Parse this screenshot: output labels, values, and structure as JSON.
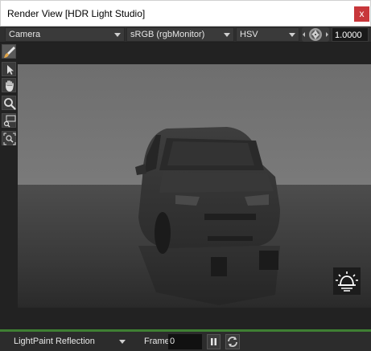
{
  "window": {
    "title": "Render View [HDR Light Studio]",
    "close_glyph": "x"
  },
  "toolbar": {
    "camera_select": "Camera",
    "colorspace_select": "sRGB (rgbMonitor)",
    "colormode_select": "HSV",
    "exposure_icon": "aperture-icon",
    "exposure_value": "1.0000"
  },
  "tools": [
    {
      "name": "paint-brush-icon",
      "active": true
    },
    {
      "name": "pointer-arrow-icon",
      "active": false
    },
    {
      "name": "hand-pan-icon",
      "active": false
    },
    {
      "name": "magnifier-zoom-icon",
      "active": false
    },
    {
      "name": "region-zoom-icon",
      "active": false
    },
    {
      "name": "zoom-fit-icon",
      "active": false
    }
  ],
  "viewport": {
    "subject": "car-render",
    "light_button_icon": "light-dome-icon"
  },
  "bottom_bar": {
    "mode_select": "LightPaint Reflection",
    "frame_label": "Frame",
    "frame_value": "0",
    "pause_icon": "pause-icon",
    "refresh_icon": "refresh-icon"
  },
  "colors": {
    "accent_close": "#c8373b",
    "status_green": "#3f7f33",
    "panel_bg": "#2f2f2f"
  }
}
